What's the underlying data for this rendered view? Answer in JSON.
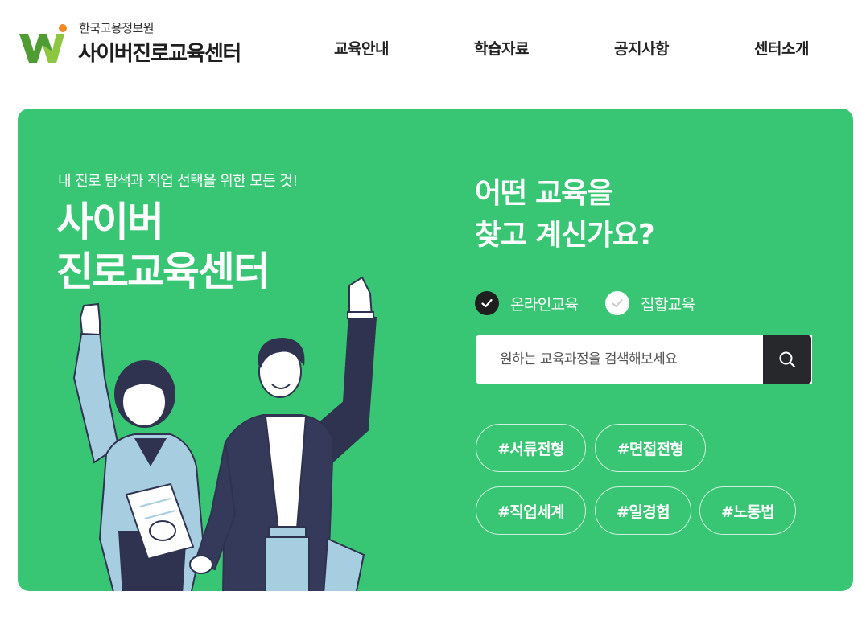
{
  "brand": {
    "org_name": "한국고용정보원",
    "site_name": "사이버진로교육센터",
    "logo_colors": {
      "green_dark": "#4f9b34",
      "green_light": "#8dc63f",
      "dot": "#f08a24"
    }
  },
  "nav": {
    "items": [
      {
        "label": "교육안내"
      },
      {
        "label": "학습자료"
      },
      {
        "label": "공지사항"
      },
      {
        "label": "센터소개"
      }
    ]
  },
  "hero": {
    "background_color": "#38c674",
    "tagline": "내 진로 탐색과 직업 선택을 위한 모든 것!",
    "title_line1": "사이버",
    "title_line2": "진로교육센터",
    "illustration": "two-people-cheering-illustration"
  },
  "finder": {
    "question_line1": "어떤 교육을",
    "question_line2": "찾고 계신가요?",
    "options": [
      {
        "label": "온라인교육",
        "checked": true
      },
      {
        "label": "집합교육",
        "checked": false
      }
    ],
    "search": {
      "placeholder": "원하는 교육과정을 검색해보세요",
      "value": "",
      "button_icon": "search-icon"
    },
    "tags": [
      {
        "label": "#서류전형"
      },
      {
        "label": "#면접전형"
      },
      {
        "label": "#직업세계"
      },
      {
        "label": "#일경험"
      },
      {
        "label": "#노동법"
      }
    ]
  }
}
